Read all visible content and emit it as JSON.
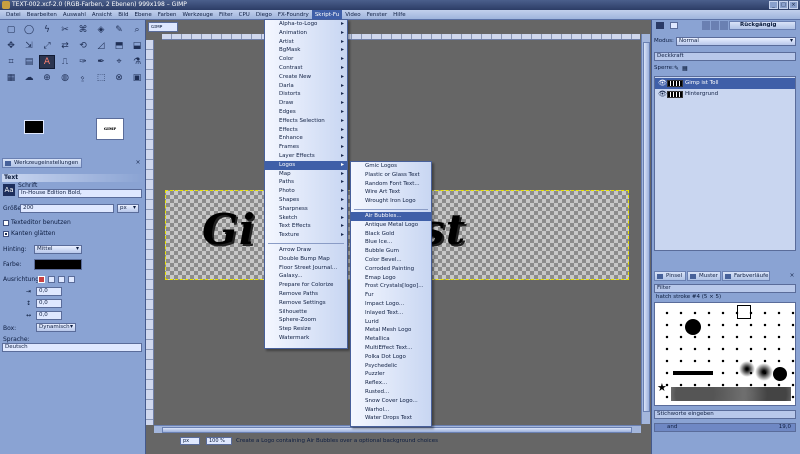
{
  "window": {
    "title": "TEXT-002.xcf-2.0 (RGB-Farben, 2 Ebenen) 999x198 – GIMP",
    "buttons": [
      "_",
      "□",
      "×"
    ]
  },
  "menubar": {
    "items": [
      "Datei",
      "Bearbeiten",
      "Auswahl",
      "Ansicht",
      "Bild",
      "Ebene",
      "Farben",
      "Werkzeuge",
      "Filter",
      "CPU",
      "Diego",
      "FX-Foundry",
      "Skript-Fu",
      "Video",
      "Fenster",
      "Hilfe"
    ],
    "active": "Skript-Fu"
  },
  "toolbox": {
    "tools": [
      "▢",
      "◯",
      "ϟ",
      "✂",
      "⌘",
      "◈",
      "✎",
      "⌕",
      "✥",
      "⇲",
      "⤢",
      "⇄",
      "⟲",
      "◿",
      "⬒",
      "⬓",
      "⌗",
      "▤",
      "A",
      "⎍",
      "✑",
      "✒",
      "⌖",
      "⚗",
      "▦",
      "☁",
      "⊕",
      "◍",
      "⍚",
      "⬚",
      "⊗",
      "▣"
    ],
    "active_index": 18,
    "tool_options_tab": "Werkzeugeinstellungen",
    "section_title": "Text",
    "font_label": "Schrift",
    "font_value": "In-House Edition Bold,",
    "size_label": "Größe:",
    "size_value": "200",
    "size_unit": "px",
    "use_editor": "Texteditor benutzen",
    "antialias": "Kanten glätten",
    "hinting_label": "Hinting:",
    "hinting_value": "Mittel",
    "color_label": "Farbe:",
    "justify_label": "Ausrichtung",
    "indent_value": "0,0",
    "linespacing_value": "0,0",
    "letterspacing_value": "0,0",
    "box_label": "Box:",
    "box_value": "Dynamisch",
    "language_label": "Sprache:",
    "language_value": "Deutsch"
  },
  "canvas": {
    "image_tab": "ɢɪᴍᴘ",
    "image_text": "Gi           gin Test",
    "status_unit": "px",
    "zoom": "100 %",
    "status_message": "Create a Logo containing Air Bubbles over a optional background choices"
  },
  "script_fu_menu": {
    "items": [
      {
        "label": "Alpha-to-Logo",
        "arrow": true
      },
      {
        "label": "Animation",
        "arrow": true
      },
      {
        "label": "Artist",
        "arrow": true
      },
      {
        "label": "BgMask",
        "arrow": true
      },
      {
        "label": "Color",
        "arrow": true
      },
      {
        "label": "Contrast",
        "arrow": true
      },
      {
        "label": "Create New",
        "arrow": true
      },
      {
        "label": "Darla",
        "arrow": true
      },
      {
        "label": "Distorts",
        "arrow": true
      },
      {
        "label": "Draw",
        "arrow": true
      },
      {
        "label": "Edges",
        "arrow": true
      },
      {
        "label": "Effects Selection",
        "arrow": true
      },
      {
        "label": "Effects",
        "arrow": true
      },
      {
        "label": "Enhance",
        "arrow": true
      },
      {
        "label": "Frames",
        "arrow": true
      },
      {
        "label": "Layer Effects",
        "arrow": true
      },
      {
        "label": "Logos",
        "arrow": true,
        "selected": true
      },
      {
        "label": "Map",
        "arrow": true
      },
      {
        "label": "Paths",
        "arrow": true
      },
      {
        "label": "Photo",
        "arrow": true
      },
      {
        "label": "Shapes",
        "arrow": true
      },
      {
        "label": "Sharpness",
        "arrow": true
      },
      {
        "label": "Sketch",
        "arrow": true
      },
      {
        "label": "Text Effects",
        "arrow": true
      },
      {
        "label": "Texture",
        "arrow": true
      }
    ],
    "extra_items": [
      "Arrow Draw",
      "Double Bump Map",
      "Floor Street Journal...",
      "Galaxy...",
      "Prepare for Colorize",
      "Remove Paths",
      "Remove Settings",
      "Silhouette",
      "Sphere-Zoom",
      "Step Resize",
      "Watermark"
    ]
  },
  "logos_menu": {
    "items_top": [
      "Gmic Logos",
      "Plastic or Glass Text",
      "Random Font Text...",
      "Wire Art Text",
      "Wrought Iron Logo"
    ],
    "items": [
      "Air Bubbles...",
      "Antique Metal Logo",
      "Black Gold",
      "Blue Ice...",
      "Bubble Gum",
      "Color Bevel...",
      "Corroded Painting",
      "Emap Logo",
      "Frost Crystals[logo]...",
      "Fur",
      "Impact Logo...",
      "Inlayed Text...",
      "Lurid",
      "Metal Mesh Logo",
      "Metallica",
      "MultiEffect Text...",
      "Polka Dot Logo",
      "Psychedelic",
      "Puzzler",
      "Reflex...",
      "Rusted...",
      "Snow Cover Logo...",
      "Warhol...",
      "Water Drops Text"
    ],
    "selected": "Air Bubbles..."
  },
  "dock": {
    "undo_label": "Rückgängig",
    "mode_label": "Modus:",
    "mode_value": "Normal",
    "opacity_label": "Deckkraft",
    "lock_label": "Sperre:",
    "layers": [
      {
        "name": "Gimp ist Toll",
        "selected": true
      },
      {
        "name": "Hintergrund",
        "selected": false
      }
    ],
    "brush_tabs": [
      "Pinsel",
      "Muster",
      "Farbverläufe"
    ],
    "brush_filter": "Filter",
    "brush_name": "hatch stroke #4 (5 × 5)",
    "tags_placeholder": "Stichworte eingeben",
    "spacing_label": "and",
    "spacing_value": "19,0"
  }
}
